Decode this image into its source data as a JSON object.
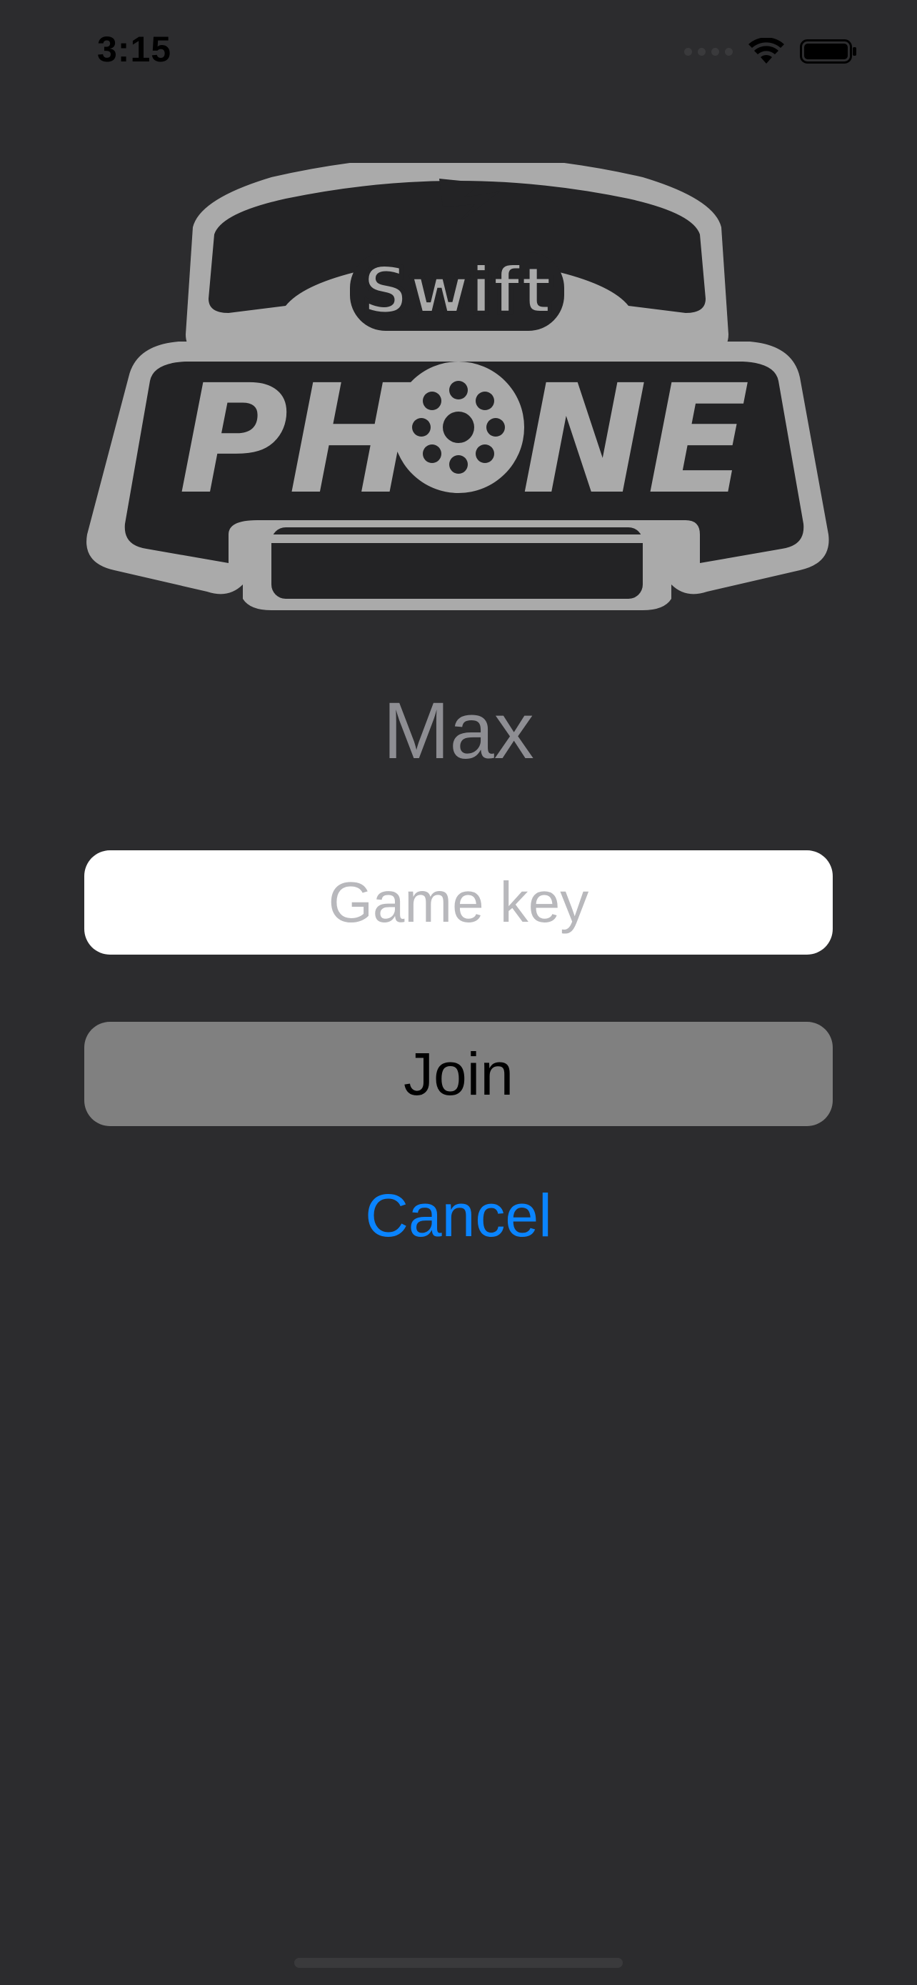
{
  "status_bar": {
    "time": "3:15"
  },
  "logo": {
    "top_text": "Swift",
    "main_text_left": "PH",
    "main_text_right": "NE"
  },
  "player": {
    "name": "Max"
  },
  "game_key": {
    "value": "",
    "placeholder": "Game key"
  },
  "buttons": {
    "join_label": "Join",
    "cancel_label": "Cancel"
  },
  "colors": {
    "background": "#2c2c2e",
    "field": "#ffffff",
    "join_button": "#808080",
    "cancel_text": "#0a84ff",
    "name_text": "#8e8e93"
  },
  "icons": [
    "wifi-icon",
    "battery-icon",
    "cellular-signal-icon",
    "telephone-logo-icon"
  ]
}
